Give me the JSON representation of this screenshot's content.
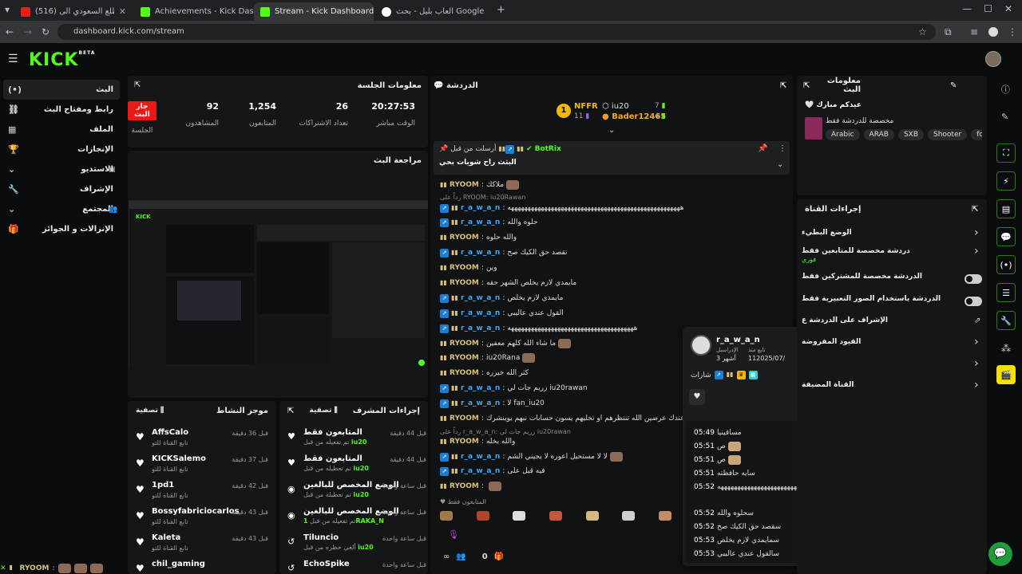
{
  "browser": {
    "tabs": [
      {
        "label": "(516) هل تقدر تطلع السعودي الى",
        "active": false
      },
      {
        "label": "Achievements - Kick Dashboard",
        "active": false
      },
      {
        "label": "Stream - Kick Dashboard",
        "active": true
      },
      {
        "label": "العاب بليل - بحث Google",
        "active": false
      }
    ],
    "url": "dashboard.kick.com/stream"
  },
  "app": {
    "logo": "KICK",
    "logo_sup": "BETA"
  },
  "sidebar": {
    "items": [
      {
        "label": "البث",
        "icon": "live-icon",
        "active": true
      },
      {
        "label": "رابط ومفتاح البث",
        "icon": "link-icon"
      },
      {
        "label": "الملف",
        "icon": "profile-icon"
      },
      {
        "label": "الإنجازات",
        "icon": "trophy-icon"
      },
      {
        "label": "الاستديو",
        "icon": "studio-icon"
      },
      {
        "label": "الإشراف",
        "icon": "wrench-icon"
      },
      {
        "label": "المجتمع",
        "icon": "community-icon"
      },
      {
        "label": "الإنزالات و الجوائز",
        "icon": "gift-icon"
      }
    ]
  },
  "session": {
    "title": "معلومات الجلسة",
    "live_badge": "جار البث",
    "session_label": "الجلسة",
    "stats": [
      {
        "value": "92",
        "label": "المشاهدون"
      },
      {
        "value": "1,254",
        "label": "المتابعون"
      },
      {
        "value": "26",
        "label": "تعداد الاشتراكات"
      },
      {
        "value": "20:27:53",
        "label": "الوقت مباشر"
      }
    ]
  },
  "review": {
    "title": "مراجعة البث"
  },
  "activity": {
    "title": "موجز النشاط",
    "filter": "تصفية",
    "items": [
      {
        "name": "AffsCalo",
        "sub": "تابع القناة للتو",
        "time": "قبل 36 دقيقة"
      },
      {
        "name": "KICKSalemo",
        "sub": "تابع القناة للتو",
        "time": "قبل 37 دقيقة"
      },
      {
        "name": "1pd1",
        "sub": "تابع القناة للتو",
        "time": "قبل 42 دقيقة"
      },
      {
        "name": "Bossyfabriciocarlos",
        "sub": "تابع القناة للتو",
        "time": "قبل 43 دقيقة"
      },
      {
        "name": "Kaleta",
        "sub": "تابع القناة للتو",
        "time": "قبل 43 دقيقة"
      },
      {
        "name": "chil_gaming",
        "sub": "",
        "time": ""
      }
    ]
  },
  "modactions": {
    "title": "إجراءات المشرف",
    "filter": "تصفية",
    "items": [
      {
        "name": "المتابعون فقط",
        "sub_prefix": "تم تفعيله من قبل",
        "sub_user": "iu20",
        "time": "قبل 44 دقيقة",
        "icon": "heart-icon"
      },
      {
        "name": "المتابعون فقط",
        "sub_prefix": "تم تعطيله من قبل",
        "sub_user": "iu20",
        "time": "قبل 44 دقيقة",
        "icon": "heart-icon"
      },
      {
        "name": "الوضع المخصص للبالغين",
        "sub_prefix": "تم تعطيله من قبل",
        "sub_user": "iu20",
        "time": "قبل ساعة واحدة",
        "icon": "eye-icon"
      },
      {
        "name": "الوضع المخصص للبالغين",
        "sub_prefix": "تم تفعيله من قبل",
        "sub_user": "1RAKA_N",
        "time": "قبل ساعة واحدة",
        "icon": "eye-icon"
      },
      {
        "name": "Tiluncio",
        "sub_prefix": "ألغي حظره من قبل",
        "sub_user": "iu20",
        "time": "قبل ساعة واحدة",
        "icon": "undo-icon"
      },
      {
        "name": "EchoSpike",
        "sub_prefix": "",
        "sub_user": "",
        "time": "قبل ساعة واحدة",
        "icon": "undo-icon"
      }
    ]
  },
  "chat": {
    "title": "الدردشة",
    "leaderboard": [
      {
        "rank": "1",
        "name": "NFFR",
        "count": "11"
      },
      {
        "name": "iu20",
        "count": "7"
      },
      {
        "name": "Bader12465",
        "count": "4"
      }
    ],
    "pinned": {
      "by_prefix": "أرسلت من قبل",
      "by_user": "BotRix",
      "text": "البثث راح شويات بحي"
    },
    "reply_header": "رداً على RYOOM: iu20Rawan",
    "messages": [
      {
        "user": "RYOOM",
        "color": "#d7c07a",
        "text": "ملاكك",
        "emote": true
      },
      {
        "user": "r_a_w_a_n",
        "color": "#3fa9f5",
        "text": "ههههههههههههههههههههههههههههههههههههههههههههههههههههه"
      },
      {
        "user": "r_a_w_a_n",
        "color": "#3fa9f5",
        "text": "حلوه والله"
      },
      {
        "user": "RYOOM",
        "color": "#d7c07a",
        "text": "والله حلوه"
      },
      {
        "user": "r_a_w_a_n",
        "color": "#3fa9f5",
        "text": "تقصد حق الكيك صح"
      },
      {
        "user": "RYOOM",
        "color": "#d7c07a",
        "text": "وين"
      },
      {
        "user": "RYOOM",
        "color": "#d7c07a",
        "text": "مايمدي لازم يخلص الشهر حقه"
      },
      {
        "user": "r_a_w_a_n",
        "color": "#3fa9f5",
        "text": "مايمدي لازم يخلص"
      },
      {
        "user": "r_a_w_a_n",
        "color": "#3fa9f5",
        "text": "القول عندي عاليبي"
      },
      {
        "user": "r_a_w_a_n",
        "color": "#3fa9f5",
        "text": "ههههههههههههههههههههههههههههههههههههههه"
      },
      {
        "user": "RYOOM",
        "color": "#d7c07a",
        "text": "ما شاء الله كلهم معفين",
        "emote": true
      },
      {
        "user": "RYOOM",
        "color": "#d7c07a",
        "text": "iu20Rana",
        "emote": true
      },
      {
        "user": "RYOOM",
        "color": "#d7c07a",
        "text": "كثر الله خيرره"
      },
      {
        "user": "r_a_w_a_n",
        "color": "#3fa9f5",
        "text": "زريم جات لي iu20rawan"
      },
      {
        "user": "r_a_w_a_n",
        "color": "#3fa9f5",
        "text": "لا fan_iu20"
      },
      {
        "user": "RYOOM",
        "color": "#d7c07a",
        "text": "فيه عندك عرضين الله تنتظرهم او تخليهم يسون حسابات نبهم يوينشرك"
      },
      {
        "user": "RYOOM",
        "color": "#d7c07a",
        "text": "والله بخله"
      },
      {
        "user": "r_a_w_a_n",
        "color": "#3fa9f5",
        "text": "لا لا مستحيل اعوره لا يجيني الشم",
        "emote": true
      },
      {
        "user": "r_a_w_a_n",
        "color": "#3fa9f5",
        "text": "فيه قبل على"
      },
      {
        "user": "RYOOM",
        "color": "#d7c07a",
        "text": "",
        "emote": true
      }
    ],
    "reply_header2": "رداً على r_a_w_a_n: زريم جات لي iu20rawan",
    "followers_only": "المتابعون فقط",
    "footer_count": "0"
  },
  "usercard": {
    "name": "r_a_w_a_n",
    "followers_label": "الإدراسيل",
    "followers_value": "3 أشهر",
    "since_label": "تابع منذ",
    "since_value": "112025/07/",
    "badges_label": "شارات",
    "history": [
      {
        "time": "05:49",
        "text": "مساقينيا"
      },
      {
        "time": "05:51",
        "text": "ص",
        "emote": true
      },
      {
        "time": "05:51",
        "text": "ص",
        "emote": true
      },
      {
        "time": "05:51",
        "text": "سايه حافظته"
      },
      {
        "time": "05:52",
        "text": "ههههههههههههههههههههههههههههههههههههههههههههههههههههه"
      },
      {
        "time": "05:52",
        "text": "سحلوه والله"
      },
      {
        "time": "05:52",
        "text": "سقصد حق الكيك صح"
      },
      {
        "time": "05:53",
        "text": "سمايمدي لازم يخلص"
      },
      {
        "time": "05:53",
        "text": "سالقول عندي عاليبي"
      }
    ]
  },
  "streaminfo": {
    "title": "معلومات البث",
    "line1": "عيدكم مبارك",
    "line2": "مخصصة للدردشة فقط",
    "tags": [
      "Arabic",
      "ARAB",
      "SXB",
      "Shooter",
      "fortnr"
    ]
  },
  "channelactions": {
    "title": "إجراءات القناة",
    "items": [
      {
        "label": "الوضع البطيء",
        "type": "arrow"
      },
      {
        "label": "دردشة مخصصة للمتابعين فقط",
        "sub": "فوري",
        "type": "arrow"
      },
      {
        "label": "الدردشة مخصصة للمشتركين فقط",
        "type": "toggle"
      },
      {
        "label": "الدردشة باستخدام الصور التعبيرية فقط",
        "type": "toggle"
      },
      {
        "label": "الإشراف على الدردشة ع",
        "type": "external"
      },
      {
        "label": "القيود المفروضة",
        "type": "arrow"
      },
      {
        "label": "",
        "type": "arrow"
      },
      {
        "label": "القناة المضيفة",
        "type": "arrow"
      }
    ]
  },
  "bottom_bar": {
    "user": "RYOOM"
  }
}
